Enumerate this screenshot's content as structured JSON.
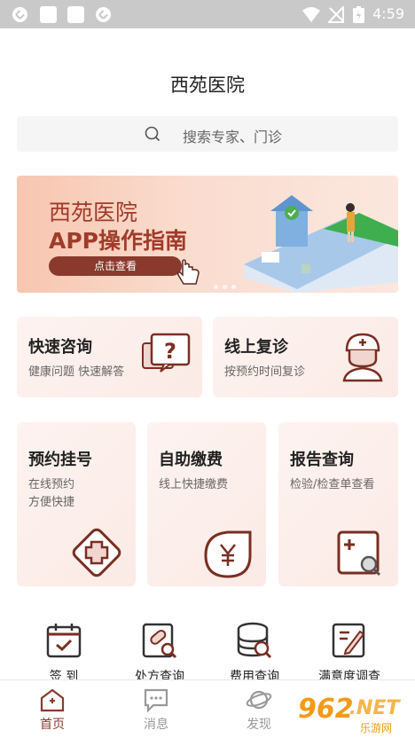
{
  "status_bar": {
    "time": "4:59"
  },
  "header": {
    "title": "西苑医院"
  },
  "search": {
    "placeholder": "搜索专家、门诊"
  },
  "banner": {
    "line1": "西苑医院",
    "line2": "APP操作指南",
    "button_label": "点击查看"
  },
  "quick_cards": [
    {
      "title": "快速咨询",
      "subtitle": "健康问题 快速解答",
      "icon": "question-chat-icon"
    },
    {
      "title": "线上复诊",
      "subtitle": "按预约时间复诊",
      "icon": "doctor-icon"
    }
  ],
  "service_cards": [
    {
      "title": "预约挂号",
      "subtitle_1": "在线预约",
      "subtitle_2": "方便快捷",
      "icon": "medical-cross-icon"
    },
    {
      "title": "自助缴费",
      "subtitle_1": "线上快捷缴费",
      "subtitle_2": "",
      "icon": "yen-payment-icon"
    },
    {
      "title": "报告查询",
      "subtitle_1": "检验/检查单查看",
      "subtitle_2": "",
      "icon": "report-search-icon"
    }
  ],
  "quick_icons": [
    {
      "label": "签 到",
      "icon": "calendar-check-icon"
    },
    {
      "label": "处方查询",
      "icon": "prescription-search-icon"
    },
    {
      "label": "费用查询",
      "icon": "coins-search-icon"
    },
    {
      "label": "满意度调查",
      "icon": "survey-edit-icon"
    }
  ],
  "tab_bar": [
    {
      "label": "首页",
      "icon": "home-icon",
      "active": true
    },
    {
      "label": "消息",
      "icon": "message-icon",
      "active": false
    },
    {
      "label": "发现",
      "icon": "planet-icon",
      "active": false
    }
  ],
  "watermark": {
    "number": "962",
    "dot": ".",
    "domain": "NET",
    "sub": "乐游网"
  },
  "colors": {
    "accent": "#8a3a2d",
    "card_bg": "#fbeae5",
    "tab_active": "#8a3a2d",
    "tab_inactive": "#999999"
  }
}
